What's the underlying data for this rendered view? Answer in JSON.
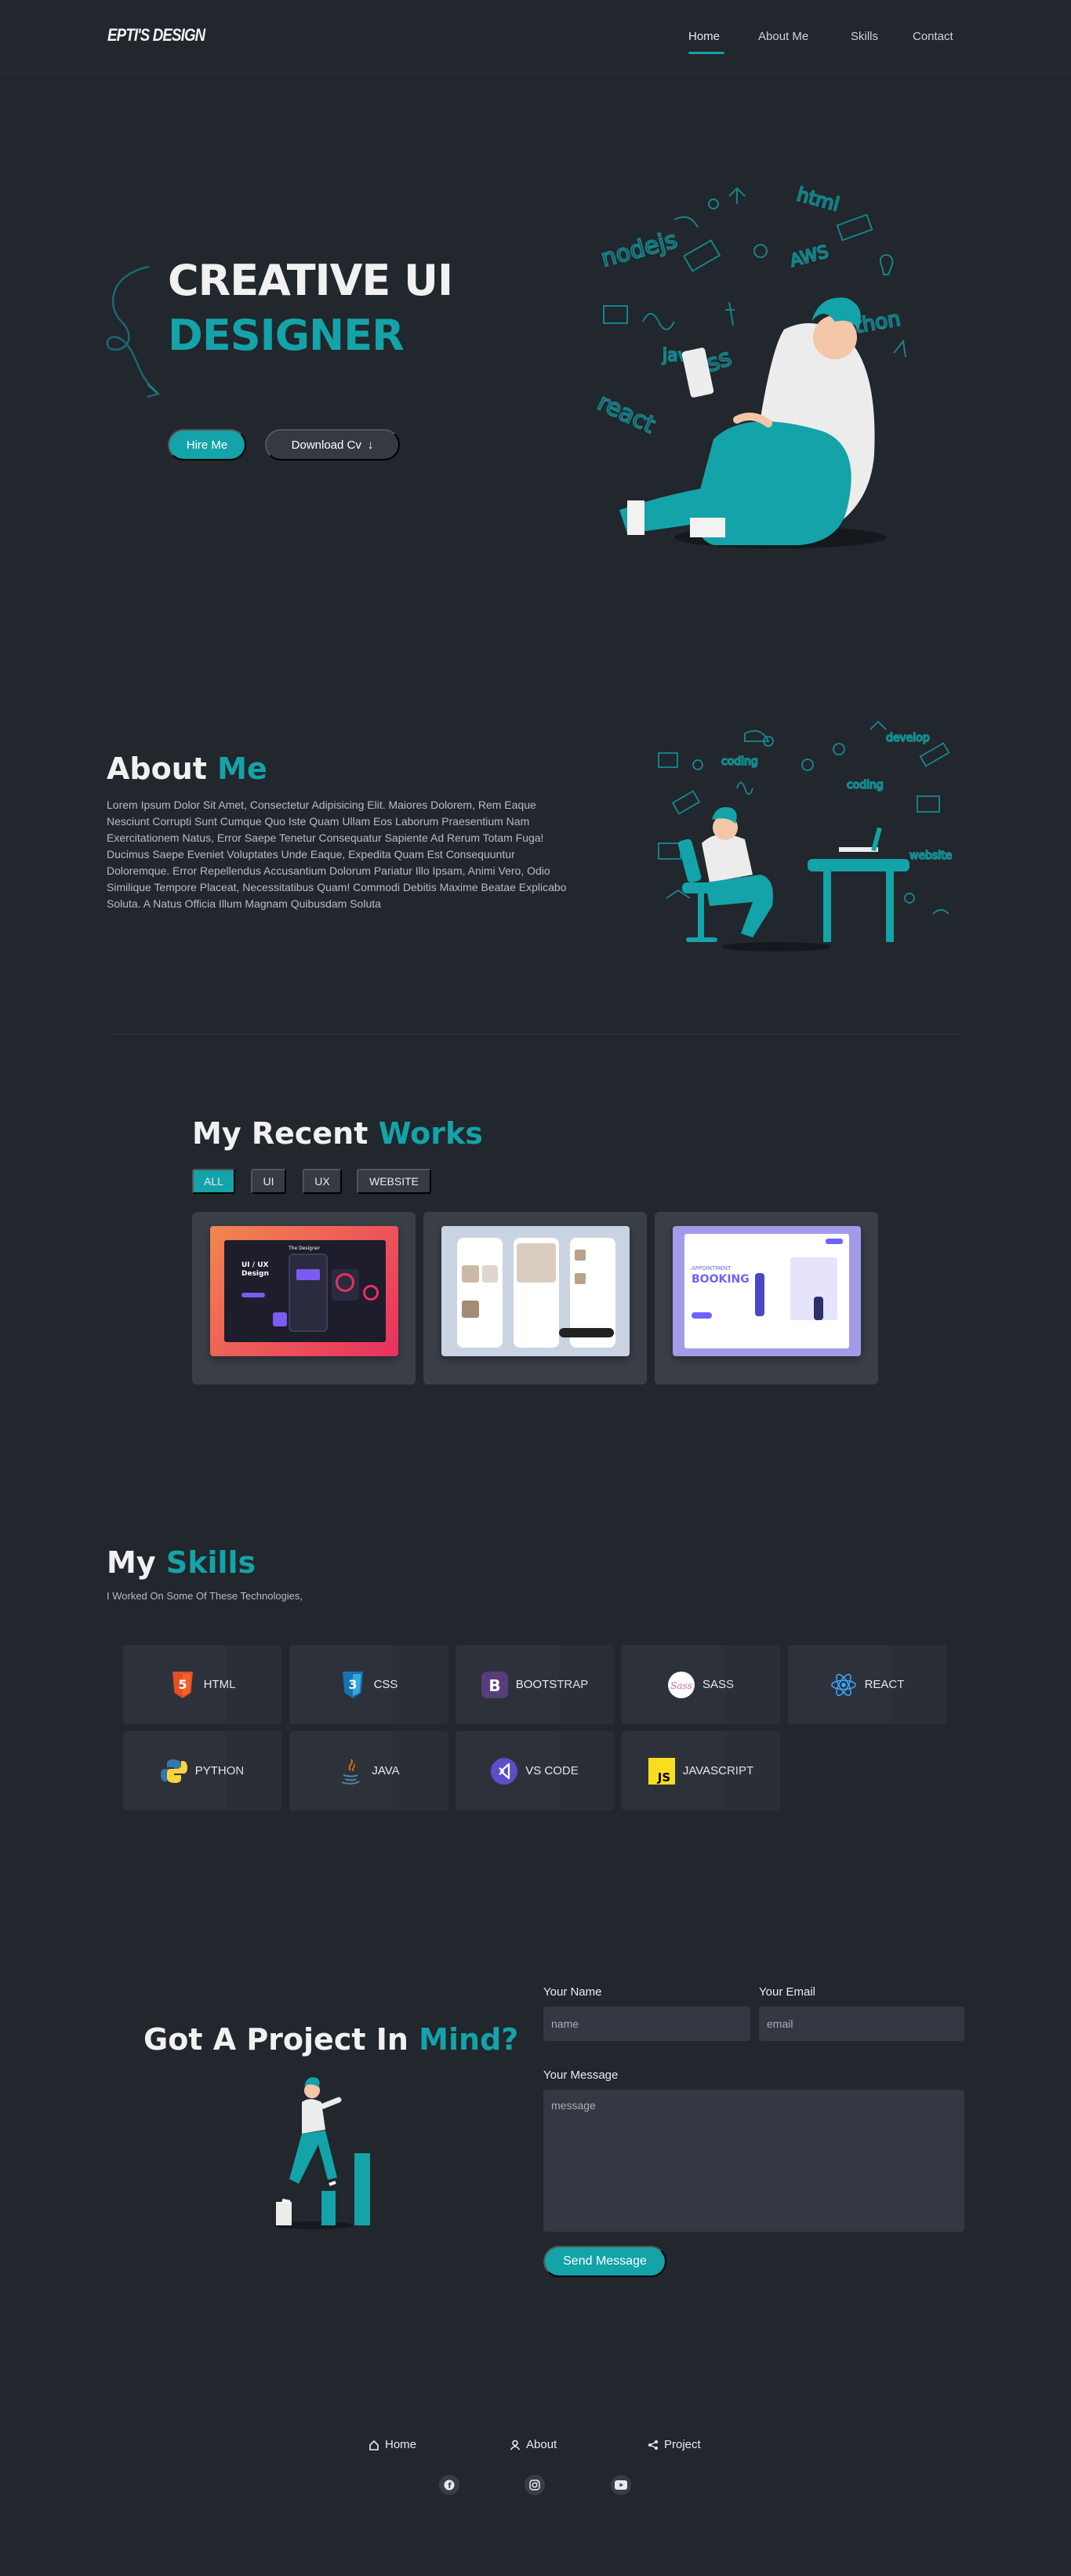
{
  "nav": {
    "logo": "EPTI'S DESIGN",
    "links": [
      "Home",
      "About Me",
      "Skills",
      "Contact"
    ]
  },
  "hero": {
    "title_line1": "CREATIVE UI",
    "title_line2": "DESIGNER",
    "hire_label": "Hire Me",
    "cv_label": "Download Cv",
    "doodle_words": [
      "html",
      "nodejs",
      "css",
      "react",
      "java",
      "python",
      "AWS"
    ]
  },
  "about": {
    "title_main": "About",
    "title_accent": "Me",
    "text": "Lorem Ipsum Dolor Sit Amet, Consectetur Adipisicing Elit. Maiores Dolorem, Rem Eaque Nesciunt Corrupti Sunt Cumque Quo Iste Quam Ullam Eos Laborum Praesentium Nam Exercitationem Natus, Error Saepe Tenetur Consequatur Sapiente Ad Rerum Totam Fuga! Ducimus Saepe Eveniet Voluptates Unde Eaque, Expedita Quam Est Consequuntur Doloremque. Error Repellendus Accusantium Dolorum Pariatur Illo Ipsam, Animi Vero, Odio Similique Tempore Placeat, Necessitatibus Quam! Commodi Debitis Maxime Beatae Explicabo Soluta. A Natus Officia Illum Magnam Quibusdam Soluta",
    "doodle_words": [
      "coding",
      "develop",
      "coding",
      "website"
    ]
  },
  "works": {
    "title_main": "My Recent",
    "title_accent": "Works",
    "filters": [
      "ALL",
      "UI",
      "UX",
      "WEBSITE"
    ],
    "active_filter": "ALL",
    "card1": {
      "heading": "UI / UX Design",
      "nav_title": "The Designer"
    },
    "card3": {
      "kicker": "APPOINTMENT",
      "heading": "BOOKING"
    }
  },
  "skills": {
    "title_main": "My",
    "title_accent": "Skills",
    "subtitle": "I Worked On Some Of These Technologies,",
    "items": [
      {
        "label": "HTML",
        "icon": "html5-icon"
      },
      {
        "label": "CSS",
        "icon": "css3-icon"
      },
      {
        "label": "BOOTSTRAP",
        "icon": "bootstrap-icon"
      },
      {
        "label": "SASS",
        "icon": "sass-icon"
      },
      {
        "label": "REACT",
        "icon": "react-icon"
      },
      {
        "label": "PYTHON",
        "icon": "python-icon"
      },
      {
        "label": "JAVA",
        "icon": "java-icon"
      },
      {
        "label": "VS CODE",
        "icon": "vscode-icon"
      },
      {
        "label": "JAVASCRIPT",
        "icon": "javascript-icon"
      }
    ]
  },
  "contact": {
    "title_main": "Got A Project In",
    "title_accent": "Mind?",
    "name_label": "Your Name",
    "name_placeholder": "name",
    "email_label": "Your Email",
    "email_placeholder": "email",
    "message_label": "Your Message",
    "message_placeholder": "message",
    "send_label": "Send Message"
  },
  "footer": {
    "links": [
      "Home",
      "About",
      "Project"
    ],
    "socials": [
      "facebook-icon",
      "instagram-icon",
      "youtube-icon"
    ]
  },
  "colors": {
    "background": "#22262d",
    "accent": "#13a3a8",
    "card": "#3a3e47",
    "field": "#343842"
  }
}
